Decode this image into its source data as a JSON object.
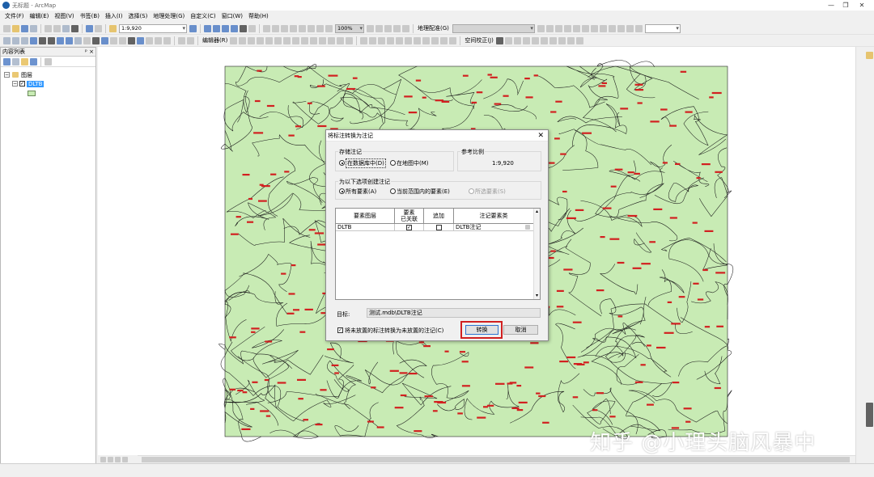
{
  "window": {
    "title": "无标题 - ArcMap",
    "controls": [
      "—",
      "❐",
      "✕"
    ]
  },
  "menu": [
    "文件(F)",
    "编辑(E)",
    "视图(V)",
    "书签(B)",
    "插入(I)",
    "选择(S)",
    "地理处理(G)",
    "自定义(C)",
    "窗口(W)",
    "帮助(H)"
  ],
  "toolbar": {
    "scale": "1:9,920",
    "zoom_pct": "100%",
    "georef_label": "地理配准(G)",
    "editor_label": "编辑器(R)",
    "spatial_adjust_label": "空间校正(J)"
  },
  "toc": {
    "title": "内容列表",
    "pin": "ᵖ ×",
    "root": "图层",
    "layer": "DLTB",
    "legend_color": "#c8ebb4"
  },
  "map": {
    "fill_color": "#c8ebb4",
    "label_color": "#d22020"
  },
  "dialog": {
    "title": "将标注转换为注记",
    "close": "✕",
    "storage_group": "存储注记",
    "opt_in_db": "在数据库中(D)",
    "opt_in_map": "在地图中(M)",
    "ref_scale_group": "参考比例",
    "ref_scale_value": "1:9,920",
    "create_group": "为以下选项创建注记",
    "opt_all": "所有要素(A)",
    "opt_extent": "当前范围内的要素(E)",
    "opt_selected": "所选要素(S)",
    "table": {
      "headers": [
        "要素图层",
        "要素\n已关联",
        "追加",
        "注记要素类"
      ],
      "rows": [
        {
          "layer": "DLTB",
          "linked": "✓",
          "append": "",
          "class": "DLTB注记"
        }
      ]
    },
    "target_label": "目标:",
    "target_value": "测试.mdb\\DLTB注记",
    "unplaced_check": "✓",
    "unplaced_label": "将未放置的标注转换为未放置的注记(C)",
    "convert_button": "转换",
    "cancel_button": "取消"
  },
  "watermark": "知乎 @小理头脑风暴中"
}
